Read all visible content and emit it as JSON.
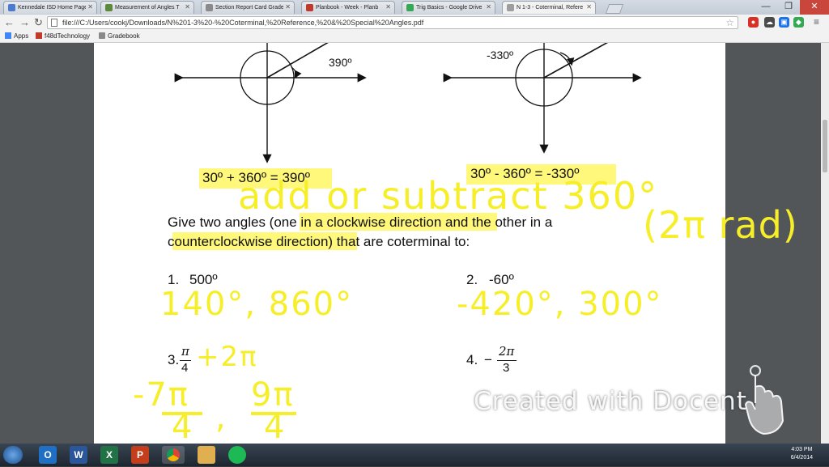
{
  "browser": {
    "tabs": [
      {
        "label": "Kennedale ISD Home Page",
        "color": "#4a7bd0"
      },
      {
        "label": "Measurement of Angles T",
        "color": "#5a8a3a"
      },
      {
        "label": "Section Report Card Grade",
        "color": "#8a8a8a"
      },
      {
        "label": "Planbook - Week - Planb",
        "color": "#c0392b"
      },
      {
        "label": "Trig Basics - Google Drive",
        "color": "#34a853"
      },
      {
        "label": "N 1-3 - Coterminal, Refere",
        "color": "#9e9e9e"
      }
    ],
    "url": "file:///C:/Users/cookj/Downloads/N%201-3%20-%20Coterminal,%20Reference,%20&%20Special%20Angles.pdf",
    "bookmarks": [
      {
        "label": "Apps",
        "color": "#4285f4"
      },
      {
        "label": "f48dTechnology",
        "color": "#c0392b"
      },
      {
        "label": "Gradebook",
        "color": "#888888"
      }
    ],
    "window_controls": [
      "—",
      "❐",
      "✕"
    ]
  },
  "document": {
    "fig1_label": "390º",
    "fig2_label": "-330º",
    "eq1": "30º + 360º = 390º",
    "eq2": "30º - 360º = -330º",
    "prompt_line1": "Give two angles (one in a clockwise direction and the other in a",
    "prompt_line2": "counterclockwise direction) that are coterminal to:",
    "problems": [
      {
        "num": "1.",
        "value": "500º"
      },
      {
        "num": "2.",
        "value": "-60º"
      },
      {
        "num": "3.",
        "value_num": "π",
        "value_den": "4"
      },
      {
        "num": "4.",
        "sign": "−",
        "value_num": "2π",
        "value_den": "3"
      }
    ]
  },
  "handwriting": {
    "rule": "add or subtract 360°",
    "rule2": "(2π rad)",
    "ans1": "140°, 860°",
    "ans2": "-420°, 300°",
    "work3": "+2π",
    "ans3a_num": "-7π",
    "ans3a_den": "4",
    "ans3b_num": "9π",
    "ans3b_den": "4",
    "ink_color": "#f7ee2a"
  },
  "watermark": "Created with Docent",
  "taskbar": {
    "apps": [
      {
        "name": "outlook",
        "letter": "O",
        "color": "#1f6fc5"
      },
      {
        "name": "word",
        "letter": "W",
        "color": "#2b579a"
      },
      {
        "name": "excel",
        "letter": "X",
        "color": "#217346"
      },
      {
        "name": "powerpoint",
        "letter": "P",
        "color": "#c43e1c"
      },
      {
        "name": "chrome",
        "letter": "",
        "color": "#e8b020"
      },
      {
        "name": "explorer",
        "letter": "",
        "color": "#e0b050"
      },
      {
        "name": "spotify",
        "letter": "",
        "color": "#2d2d2d"
      }
    ],
    "time": "4:03 PM",
    "date": "6/4/2014"
  }
}
